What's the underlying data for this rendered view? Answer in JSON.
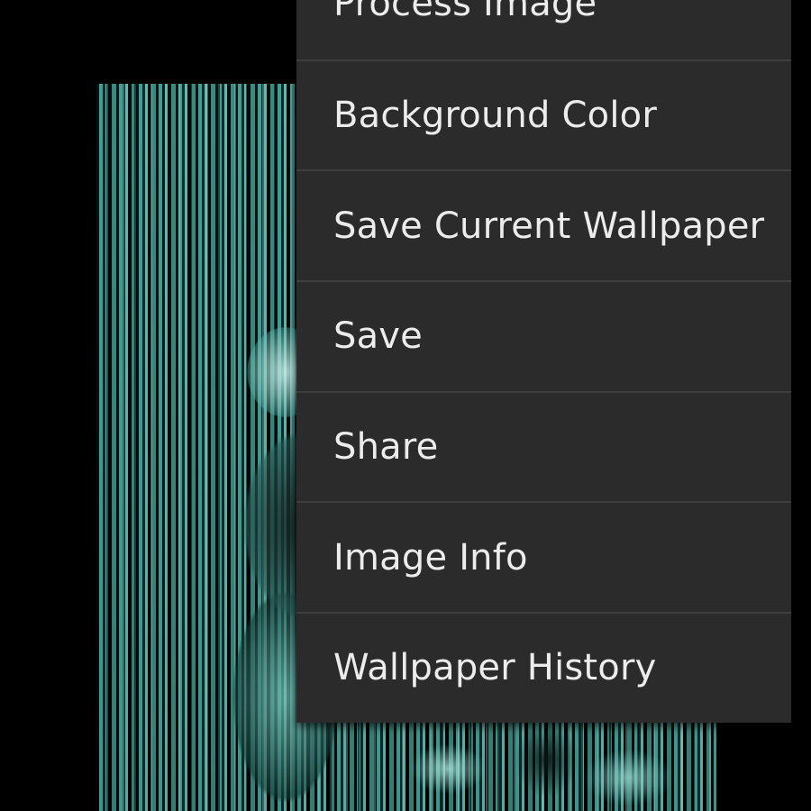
{
  "menu": {
    "items": [
      {
        "label": "Process Image"
      },
      {
        "label": "Background Color"
      },
      {
        "label": "Save Current Wallpaper"
      },
      {
        "label": "Save"
      },
      {
        "label": "Share"
      },
      {
        "label": "Image Info"
      },
      {
        "label": "Wallpaper History"
      }
    ]
  },
  "colors": {
    "background": "#000000",
    "menu_background": "#2b2b2b",
    "menu_divider": "#3e3e3e",
    "menu_text": "#ececec",
    "wallpaper_accent": "#2e7d76"
  }
}
